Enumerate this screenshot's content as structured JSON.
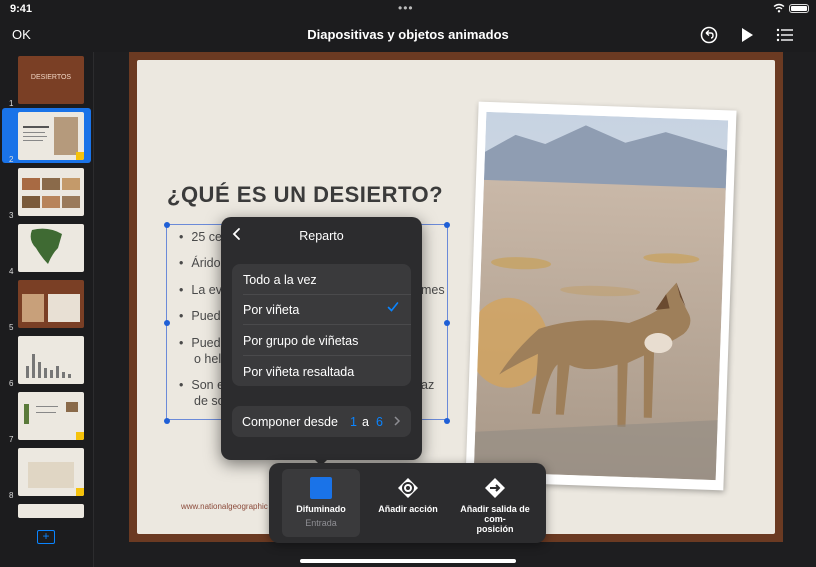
{
  "status_bar": {
    "time": "9:41",
    "dots": "•••"
  },
  "toolbar": {
    "ok_label": "OK",
    "title": "Diapositivas y objetos animados"
  },
  "sidebar": {
    "slides": [
      {
        "number": "1",
        "title": "DESIERTOS"
      },
      {
        "number": "2"
      },
      {
        "number": "3"
      },
      {
        "number": "4"
      },
      {
        "number": "5"
      },
      {
        "number": "6"
      },
      {
        "number": "7"
      },
      {
        "number": "8"
      }
    ],
    "add_slide_label": "+"
  },
  "slide": {
    "title": "¿QUÉ ES UN DESIERTO?",
    "bullets": [
      "25 centí",
      "Árido, s",
      "La evap",
      "Puede h",
      "Pueden",
      "o helado",
      "Son el h",
      "de sobre"
    ],
    "bullet_right": [
      "mes",
      "az"
    ],
    "website": "www.nationalgeographic"
  },
  "popover": {
    "title": "Reparto",
    "options": [
      "Todo a la vez",
      "Por viñeta",
      "Por grupo de viñetas",
      "Por viñeta resaltada"
    ],
    "selected": "Por viñeta",
    "build_from_label": "Componer desde",
    "build_from_start": "1",
    "build_from_to": "a",
    "build_from_end": "6"
  },
  "animation_panel": {
    "options": [
      {
        "label": "Difuminado",
        "sublabel": "Entrada"
      },
      {
        "label": "Añadir acción"
      },
      {
        "label": "Añadir salida de com-posición",
        "line1": "Añadir salida de com-",
        "line2": "posición"
      }
    ]
  },
  "colors": {
    "accent": "#0a84ff",
    "canvas_frame": "#6b3a22",
    "slide_bg": "#ece8e0"
  }
}
